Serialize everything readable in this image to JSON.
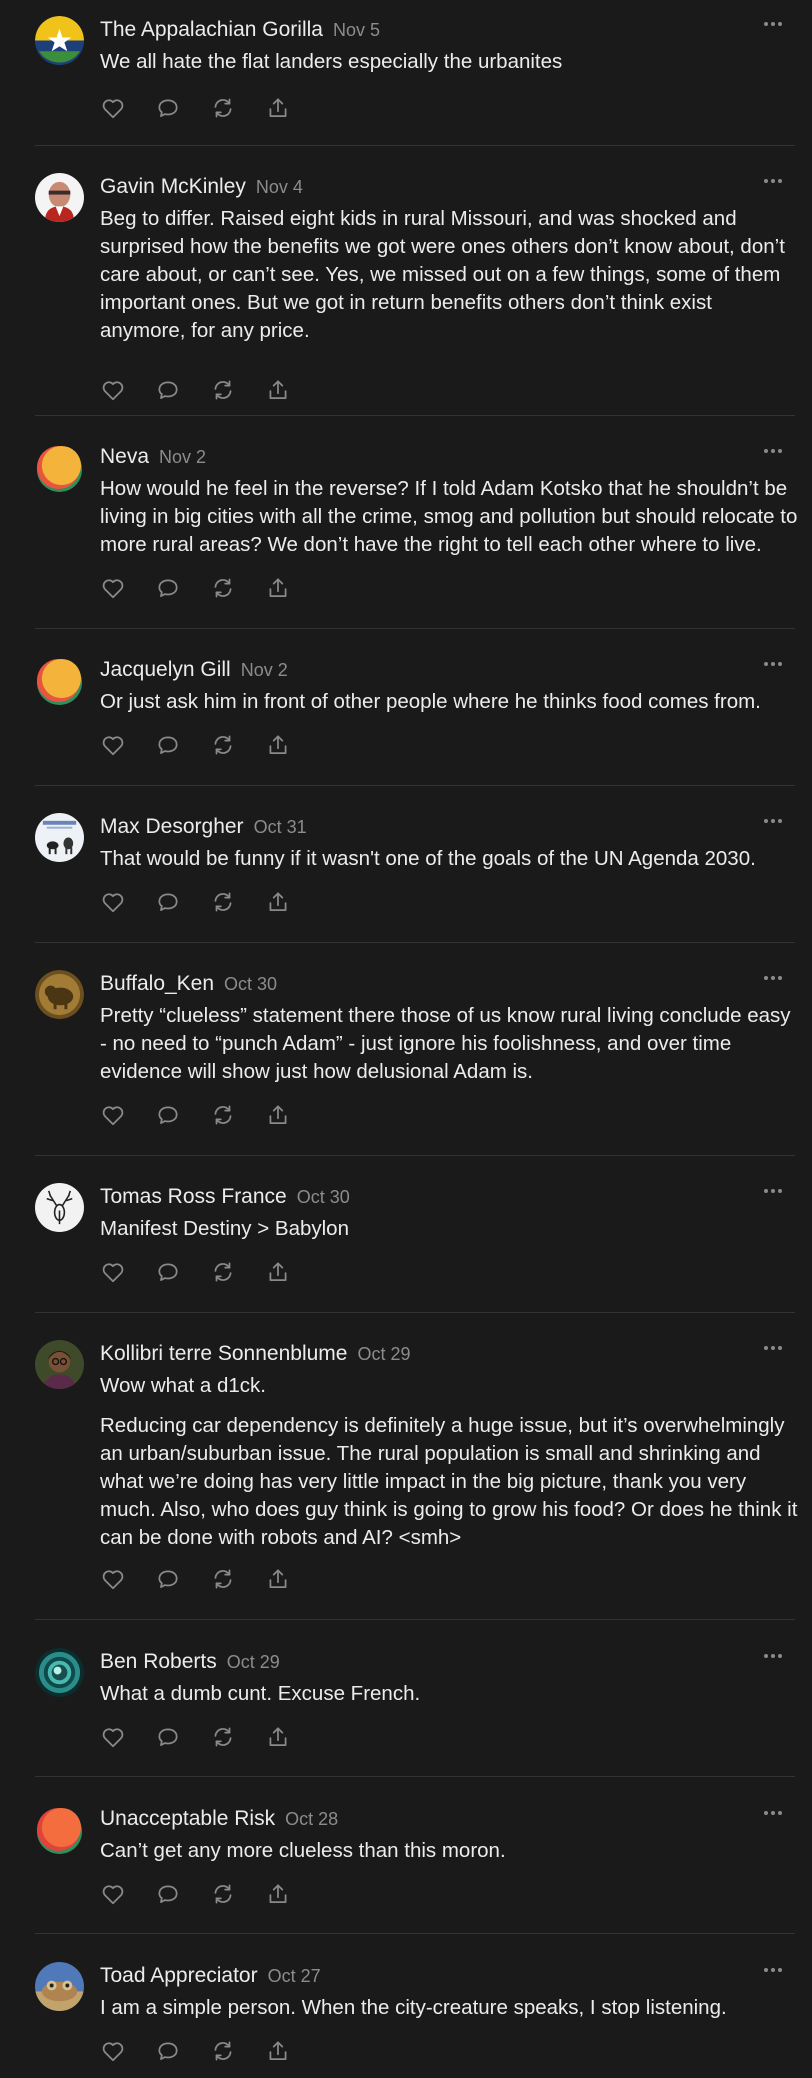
{
  "comments": [
    {
      "author": "The Appalachian Gorilla",
      "date": "Nov 5",
      "avatar": "flag-star-avatar",
      "paragraphs": [
        "We all hate the flat landers especially the urbanites"
      ]
    },
    {
      "author": "Gavin McKinley",
      "date": "Nov 4",
      "avatar": "man-portrait-avatar",
      "paragraphs": [
        "Beg to differ. Raised eight kids in rural Missouri, and was shocked and surprised how the benefits we got were ones others don’t know about, don’t care about, or can’t see. Yes, we missed out on a few things, some of them important ones. But we got in return benefits others don’t think exist anymore, for any price."
      ]
    },
    {
      "author": "Neva",
      "date": "Nov 2",
      "avatar": "orange-yellow-avatar",
      "paragraphs": [
        "How would he feel in the reverse? If I told Adam Kotsko that he shouldn’t be living in big cities with all the crime, smog and pollution but should relocate to more rural areas? We don’t have the right to tell each other where to live."
      ]
    },
    {
      "author": "Jacquelyn Gill",
      "date": "Nov 2",
      "avatar": "orange-yellow-avatar",
      "paragraphs": [
        "Or just ask him in front of other people where he thinks food comes from."
      ]
    },
    {
      "author": "Max Desorgher",
      "date": "Oct 31",
      "avatar": "animals-illustration-avatar",
      "paragraphs": [
        "That would be funny if it wasn't one of the goals of the UN Agenda 2030."
      ]
    },
    {
      "author": "Buffalo_Ken",
      "date": "Oct 30",
      "avatar": "bronze-buffalo-avatar",
      "paragraphs": [
        "Pretty “clueless” statement there those of us know rural living conclude easy - no need to “punch Adam” - just ignore his foolishness, and over time evidence will show just how delusional Adam is."
      ]
    },
    {
      "author": "Tomas Ross France",
      "date": "Oct 30",
      "avatar": "deer-sketch-avatar",
      "paragraphs": [
        "Manifest Destiny > Babylon"
      ]
    },
    {
      "author": "Kollibri terre Sonnenblume",
      "date": "Oct 29",
      "avatar": "person-portrait-avatar",
      "paragraphs": [
        "Wow what a d1ck.",
        "Reducing car dependency is definitely a huge issue, but it’s overwhelmingly an urban/suburban issue. The rural population is small and shrinking and what we’re doing has very little impact in the big picture, thank you very much. Also, who does guy think is going to grow his food? Or does he think it can be done with robots and AI? <smh>"
      ]
    },
    {
      "author": "Ben Roberts",
      "date": "Oct 29",
      "avatar": "teal-rings-avatar",
      "paragraphs": [
        "What a dumb cunt. Excuse French."
      ]
    },
    {
      "author": "Unacceptable Risk",
      "date": "Oct 28",
      "avatar": "orange-green-avatar",
      "paragraphs": [
        "Can’t get any more clueless than this moron."
      ]
    },
    {
      "author": "Toad Appreciator",
      "date": "Oct 27",
      "avatar": "toad-photo-avatar",
      "paragraphs": [
        "I am a simple person. When the city-creature speaks, I stop listening."
      ]
    }
  ],
  "action_icons": [
    "heart-icon",
    "comment-icon",
    "restack-icon",
    "share-icon"
  ],
  "colors": {
    "background": "#1a1a1a",
    "text": "#ececec",
    "muted": "#8c8c8c",
    "divider": "#333333"
  }
}
